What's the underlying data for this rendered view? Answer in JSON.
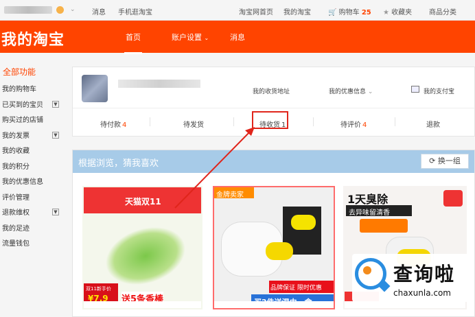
{
  "topbar": {
    "messages": "消息",
    "mobile": "手机逛淘宝",
    "home": "淘宝网首页",
    "my_taobao": "我的淘宝",
    "cart_label": "购物车",
    "cart_count": "25",
    "favorites": "收藏夹",
    "categories": "商品分类"
  },
  "header": {
    "logo": "我的淘宝",
    "nav_home": "首页",
    "nav_account": "账户设置",
    "nav_messages": "消息"
  },
  "sidebar": {
    "title": "全部功能",
    "items": [
      {
        "label": "我的购物车"
      },
      {
        "label": "已买到的宝贝"
      },
      {
        "label": "购买过的店铺"
      },
      {
        "label": "我的发票"
      },
      {
        "label": "我的收藏"
      },
      {
        "label": "我的积分"
      },
      {
        "label": "我的优惠信息"
      },
      {
        "label": "评价管理"
      },
      {
        "label": "退款维权"
      },
      {
        "label": "我的足迹"
      },
      {
        "label": "流量钱包"
      }
    ]
  },
  "account_card": {
    "address": "我的收货地址",
    "coupons": "我的优惠信息",
    "alipay": "我的支付宝"
  },
  "order_status": [
    {
      "label": "待付款",
      "count": "4"
    },
    {
      "label": "待发货",
      "count": ""
    },
    {
      "label": "待收货",
      "count": "1"
    },
    {
      "label": "待评价",
      "count": "4"
    },
    {
      "label": "退款",
      "count": ""
    }
  ],
  "recommend": {
    "title": "根据浏览，猜我喜欢",
    "swap": "换一组",
    "products": [
      {
        "tag1": "天猫双11",
        "tag2": "送5条香棒",
        "tag3": "双11新手价",
        "price_tag": "¥7.9"
      },
      {
        "tag1": "金牌卖家",
        "tag2": "品牌保证  限时优惠",
        "tag3": "买2件送湿巾一盒"
      },
      {
        "tag1": "1天臭除",
        "tag2": "去异味留清香"
      }
    ]
  },
  "watermark": {
    "title": "查询啦",
    "url": "chaxunla.com"
  }
}
